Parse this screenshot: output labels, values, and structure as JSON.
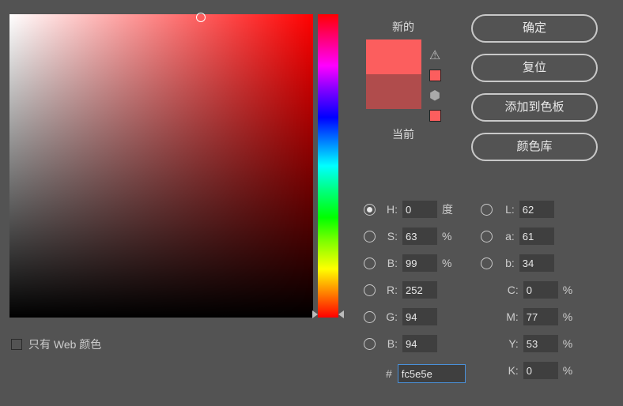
{
  "swatch": {
    "new_label": "新的",
    "current_label": "当前",
    "new_color": "#fc5e5e",
    "current_color": "#b04c4c",
    "warn_color": "#fc5e5e",
    "cube_color": "#fc5e5e"
  },
  "buttons": {
    "ok": "确定",
    "reset": "复位",
    "add": "添加到色板",
    "library": "颜色库"
  },
  "web_only": "只有 Web 颜色",
  "hsb": {
    "h_label": "H:",
    "h": "0",
    "h_unit": "度",
    "s_label": "S:",
    "s": "63",
    "s_unit": "%",
    "b_label": "B:",
    "b": "99",
    "b_unit": "%"
  },
  "rgb": {
    "r_label": "R:",
    "r": "252",
    "g_label": "G:",
    "g": "94",
    "b_label": "B:",
    "b": "94"
  },
  "lab": {
    "l_label": "L:",
    "l": "62",
    "a_label": "a:",
    "a": "61",
    "b_label": "b:",
    "b": "34"
  },
  "cmyk": {
    "c_label": "C:",
    "c": "0",
    "m_label": "M:",
    "m": "77",
    "y_label": "Y:",
    "y": "53",
    "k_label": "K:",
    "k": "0",
    "unit": "%"
  },
  "hex": {
    "prefix": "#",
    "value": "fc5e5e"
  },
  "cursor": {
    "x_pct": 63,
    "y_pct": 1
  },
  "hue_pos_pct": 99
}
